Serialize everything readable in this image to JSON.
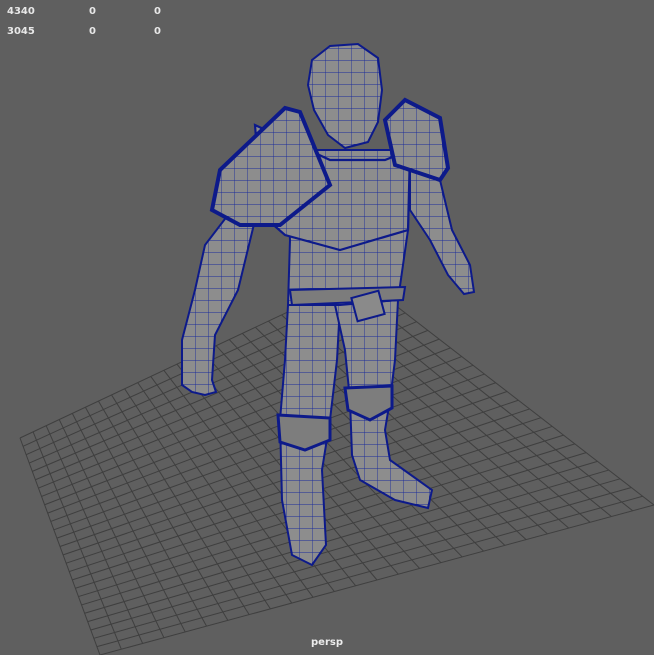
{
  "hud": {
    "rows": [
      {
        "v1": "4340",
        "v2": "0",
        "v3": "0"
      },
      {
        "v1": "3045",
        "v2": "0",
        "v3": "0"
      }
    ]
  },
  "camera": {
    "label": "persp"
  },
  "colors": {
    "background": "#5f5f5f",
    "grid": "#3f3f3f",
    "mesh_fill": "#8e8e8e",
    "wireframe": "#0d1a8a"
  },
  "icons": {
    "model": "character-wireframe-model"
  }
}
